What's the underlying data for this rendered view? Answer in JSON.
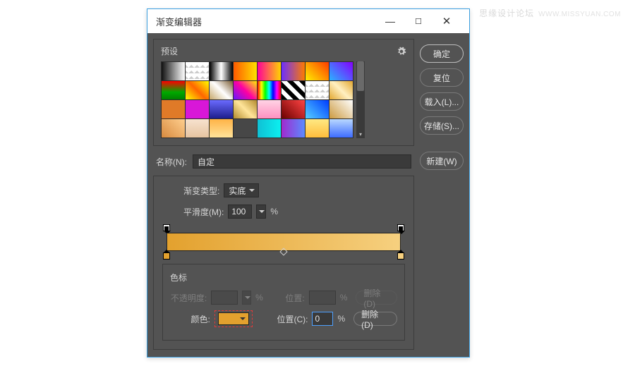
{
  "watermark": {
    "a": "思缘设计论坛",
    "b": "WWW.MISSYUAN.COM"
  },
  "title": "渐变编辑器",
  "presets_label": "预设",
  "buttons": {
    "ok": "确定",
    "reset": "复位",
    "load": "载入(L)...",
    "save": "存储(S)...",
    "new": "新建(W)"
  },
  "name": {
    "label": "名称(N):",
    "value": "自定"
  },
  "type": {
    "label": "渐变类型:",
    "value": "实底"
  },
  "smooth": {
    "label": "平滑度(M):",
    "value": "100",
    "unit": "%"
  },
  "stops": {
    "header": "色标",
    "opacity_label": "不透明度:",
    "opacity_unit": "%",
    "pos_label_a": "位置:",
    "pos_unit": "%",
    "delete_a": "删除(D)",
    "color_label": "颜色:",
    "pos_label_b": "位置(C):",
    "pos_value": "0",
    "delete_b": "删除(D)"
  },
  "gradient": {
    "start": "#e3a12e",
    "end": "#f6d07f"
  }
}
